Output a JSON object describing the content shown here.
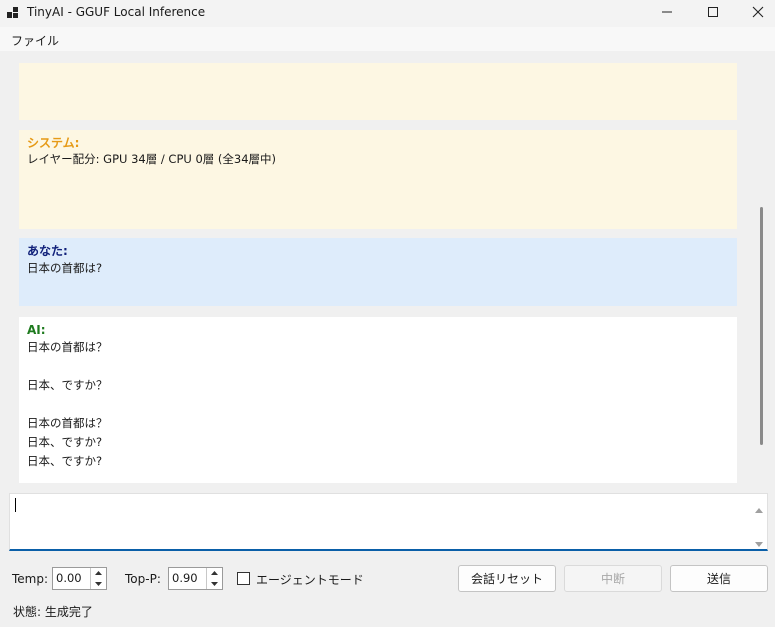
{
  "window": {
    "title": "TinyAI - GGUF Local Inference",
    "icons": {
      "app": "app-icon",
      "minimize": "minimize-icon",
      "maximize": "maximize-icon",
      "close": "close-icon"
    }
  },
  "menu": {
    "file": "ファイル"
  },
  "messages": [
    {
      "role": "system",
      "sender": "",
      "text": ""
    },
    {
      "role": "system",
      "sender": "システム:",
      "text": "レイヤー配分: GPU 34層 / CPU 0層 (全34層中)"
    },
    {
      "role": "user",
      "sender": "あなた:",
      "text": "日本の首都は?"
    },
    {
      "role": "ai",
      "sender": "AI:",
      "text": "日本の首都は？\n\n日本、ですか？\n\n日本の首都は？\n日本、ですか?\n日本、ですか?"
    }
  ],
  "input": {
    "value": ""
  },
  "controls": {
    "temp_label": "Temp:",
    "temp_value": "0.00",
    "topp_label": "Top-P:",
    "topp_value": "0.90",
    "agent_mode_label": "エージェントモード",
    "agent_mode_checked": false,
    "reset_button": "会話リセット",
    "stop_button": "中断",
    "send_button": "送信"
  },
  "status": {
    "text": "状態: 生成完了"
  },
  "colors": {
    "system_bg": "#fdf7e3",
    "system_sender": "#e69a16",
    "user_bg": "#deecfb",
    "user_sender": "#10207a",
    "ai_bg": "#ffffff",
    "ai_sender": "#1e7a1e",
    "input_accent": "#0a5fa8"
  }
}
